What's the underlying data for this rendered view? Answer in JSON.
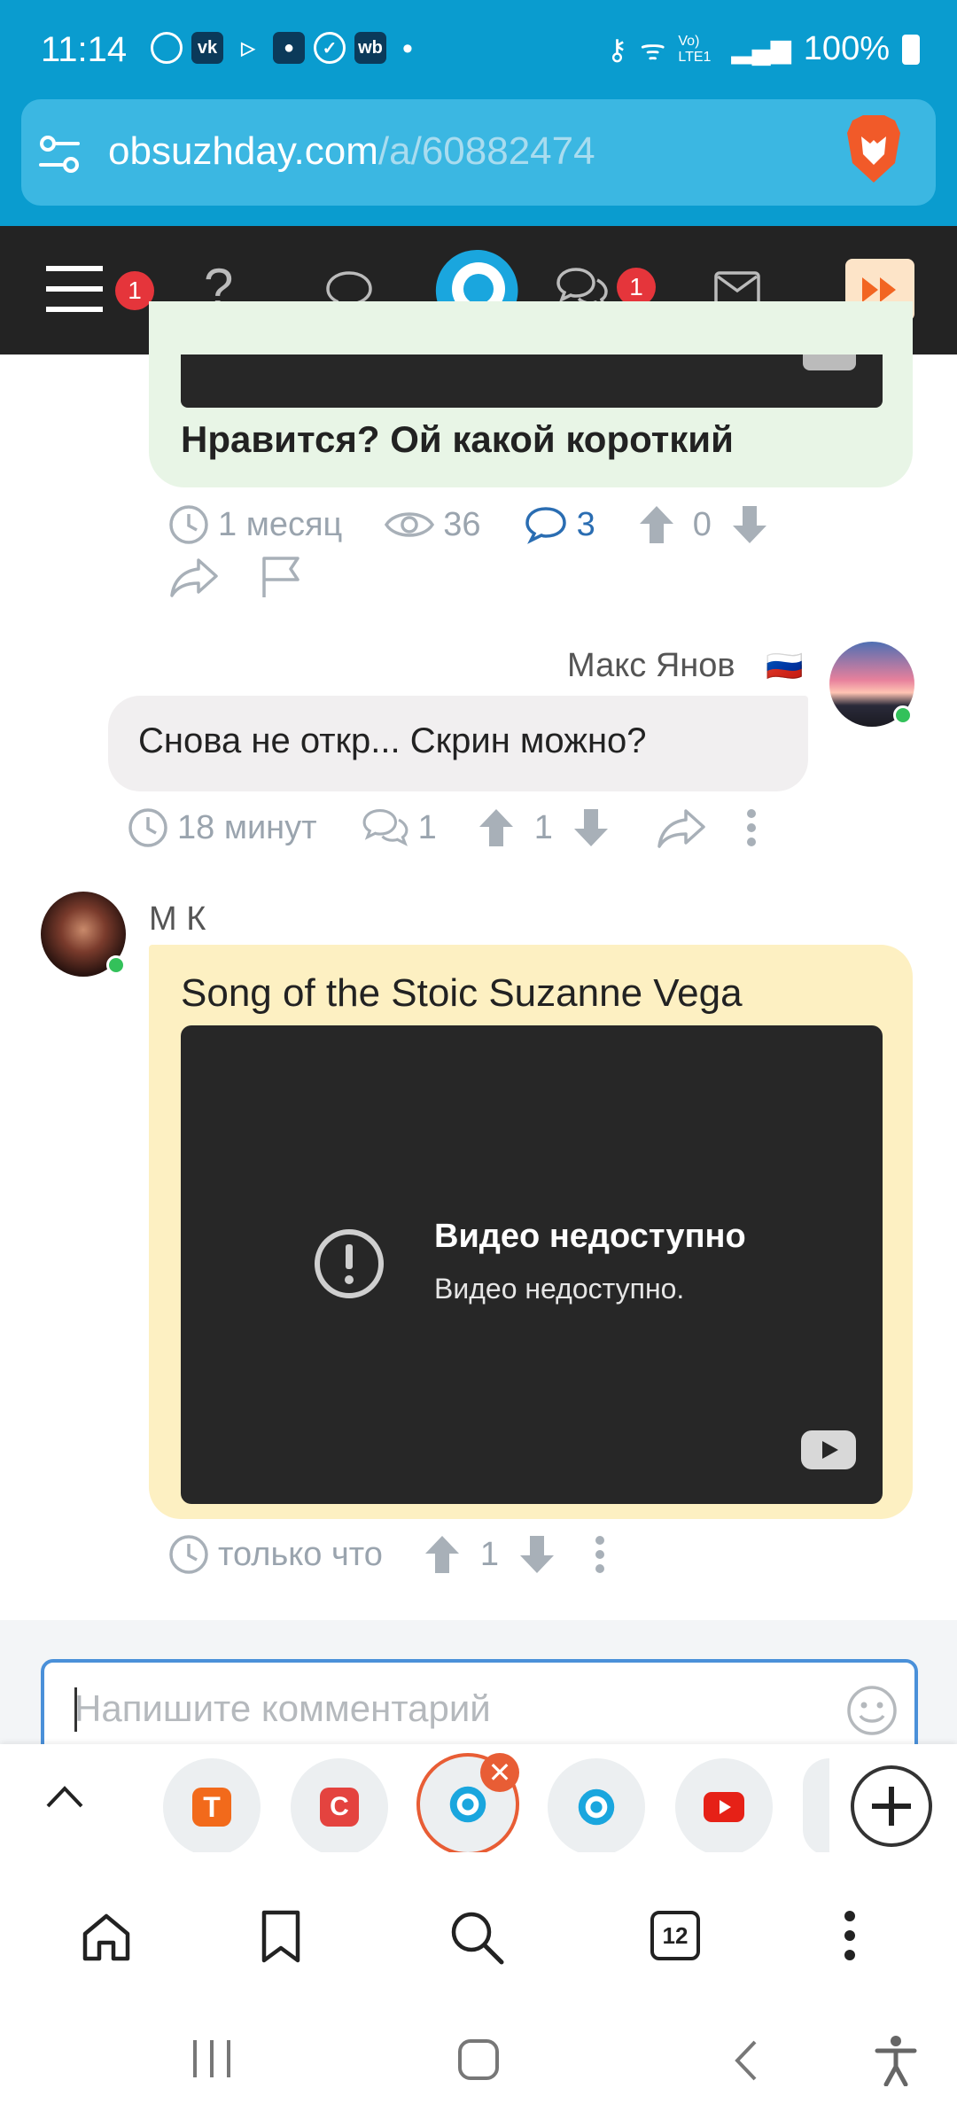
{
  "status_bar": {
    "time": "11:14",
    "app_icons": [
      "whatsapp-icon",
      "vk-icon",
      "play-store-icon",
      "contact-icon",
      "check-icon",
      "wb-icon"
    ],
    "dot": "•",
    "network_label": "Vo) LTE1",
    "battery": "100%"
  },
  "browser": {
    "url_domain": "obsuzhday.com",
    "url_path": "/a/60882474",
    "composer_placeholder": "Напишите комментарий"
  },
  "site_nav": {
    "menu_badge": "1",
    "messages_badge": "1"
  },
  "post_top": {
    "text": "Нравится? Ой какой короткий",
    "time": "1 месяц",
    "views": "36",
    "comments": "3",
    "votes": "0"
  },
  "comment_1": {
    "author": "Макс Янов",
    "flag": "🇷🇺",
    "text": "Снова не откр... Скрин можно?",
    "time": "18 минут",
    "replies": "1",
    "votes": "1"
  },
  "comment_2": {
    "author": "М К",
    "title": "Song of the Stoic Suzanne Vega",
    "video_title": "Видео недоступно",
    "video_subtitle": "Видео недоступно.",
    "time": "только что",
    "votes": "1"
  },
  "bottom_bar": {
    "tab_count": "12"
  },
  "colors": {
    "status_bar": "#0a9ccf",
    "nav_dark": "#232323",
    "badge": "#e5353b",
    "green_bubble": "#e8f5e6",
    "yellow_bubble": "#fdf0c2",
    "link_blue": "#2a6db2"
  }
}
